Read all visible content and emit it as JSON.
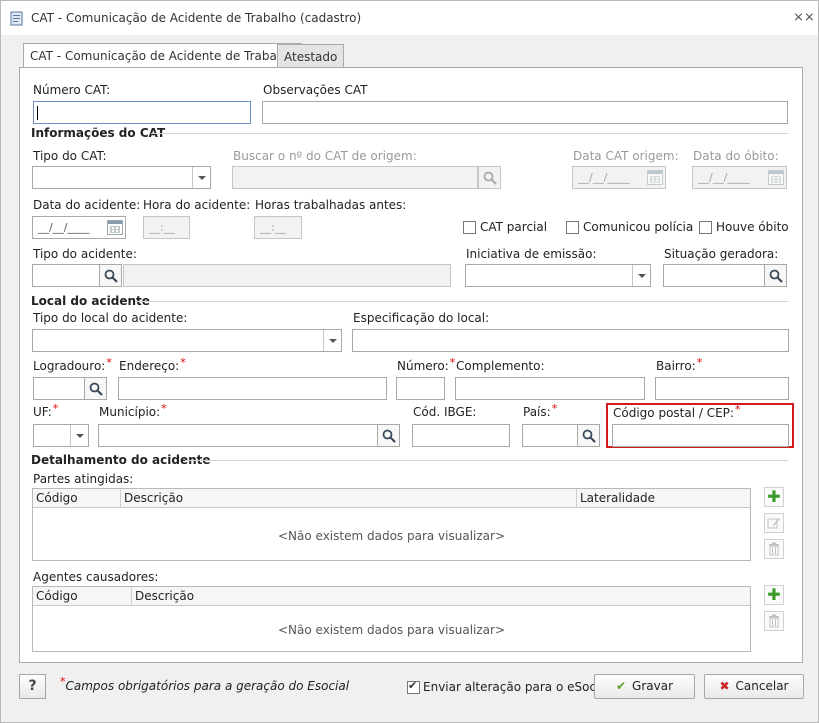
{
  "window": {
    "title": "CAT - Comunicação de Acidente de Trabalho (cadastro)",
    "close": "⨯⨯"
  },
  "tabs": [
    {
      "label": "CAT - Comunicação de Acidente de Trabalho"
    },
    {
      "label": "Atestado"
    }
  ],
  "form": {
    "numero_cat": "Número CAT:",
    "observacoes_cat": "Observações CAT",
    "sec_info": "Informações do CAT",
    "tipo_cat": "Tipo do CAT:",
    "buscar_origem": "Buscar o nº do CAT de origem:",
    "data_cat_origem": "Data CAT origem:",
    "data_obito": "Data do óbito:",
    "data_acidente": "Data do acidente:",
    "hora_acidente": "Hora do acidente:",
    "horas_trabalhadas": "Horas trabalhadas antes:",
    "date_placeholder": "__/__/____",
    "time_placeholder": "__:__",
    "cat_parcial": "CAT parcial",
    "comunicou_policia": "Comunicou polícia",
    "houve_obito": "Houve óbito",
    "tipo_acidente": "Tipo do acidente:",
    "iniciativa_emissao": "Iniciativa de emissão:",
    "situacao_geradora": "Situação geradora:",
    "sec_local": "Local do acidente",
    "tipo_local": "Tipo do local do acidente:",
    "especificacao_local": "Especificação do local:",
    "logradouro": "Logradouro:",
    "endereco": "Endereço:",
    "numero": "Número:",
    "complemento": "Complemento:",
    "bairro": "Bairro:",
    "uf": "UF:",
    "municipio": "Município:",
    "cod_ibge": "Cód. IBGE:",
    "pais": "País:",
    "codigo_postal": "Código postal / CEP:",
    "sec_detalhe": "Detalhamento do acidente",
    "partes_atingidas": "Partes atingidas:",
    "agentes_causadores": "Agentes causadores:",
    "req_mark": "*"
  },
  "grid_partes": {
    "columns": [
      "Código",
      "Descrição",
      "Lateralidade"
    ],
    "empty": "<Não existem dados para visualizar>"
  },
  "grid_agentes": {
    "columns": [
      "Código",
      "Descrição"
    ],
    "empty": "<Não existem dados para visualizar>"
  },
  "footer": {
    "help": "?",
    "note": "Campos obrigatórios para a geração do Esocial",
    "enviar": "Enviar alteração para o eSocial",
    "gravar": "Gravar",
    "cancelar": "Cancelar"
  },
  "colors": {
    "required": "#d00000",
    "highlight": "#d21a1a",
    "add": "#3a9a2a",
    "cancel": "#cc2222"
  }
}
